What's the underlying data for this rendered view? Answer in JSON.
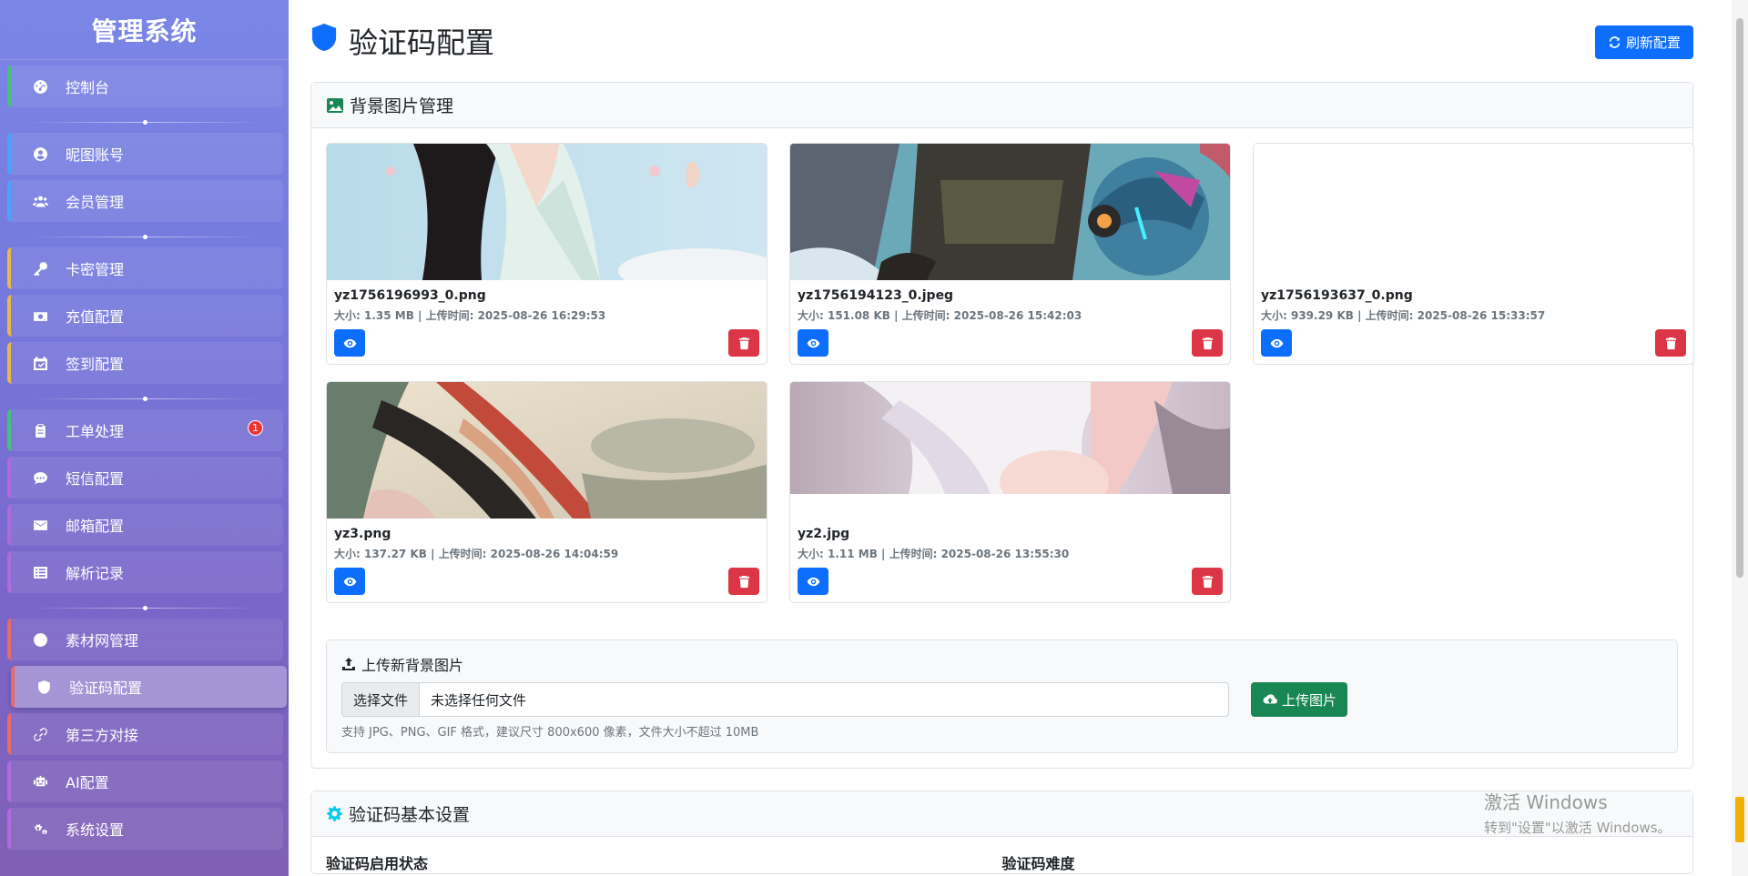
{
  "brand": "管理系统",
  "sidebar": {
    "items": [
      {
        "label": "控制台"
      },
      {
        "label": "昵图账号"
      },
      {
        "label": "会员管理"
      },
      {
        "label": "卡密管理"
      },
      {
        "label": "充值配置"
      },
      {
        "label": "签到配置"
      },
      {
        "label": "工单处理",
        "badge": "1"
      },
      {
        "label": "短信配置"
      },
      {
        "label": "邮箱配置"
      },
      {
        "label": "解析记录"
      },
      {
        "label": "素材网管理"
      },
      {
        "label": "验证码配置"
      },
      {
        "label": "第三方对接"
      },
      {
        "label": "AI配置"
      },
      {
        "label": "系统设置"
      }
    ]
  },
  "header": {
    "title": "验证码配置",
    "refresh_label": "刷新配置"
  },
  "bg_section": {
    "title": "背景图片管理",
    "images": [
      {
        "name": "yz1756196993_0.png",
        "meta": "大小: 1.35 MB | 上传时间: 2025-08-26 16:29:53"
      },
      {
        "name": "yz1756194123_0.jpeg",
        "meta": "大小: 151.08 KB | 上传时间: 2025-08-26 15:42:03"
      },
      {
        "name": "yz1756193637_0.png",
        "meta": "大小: 939.29 KB | 上传时间: 2025-08-26 15:33:57"
      },
      {
        "name": "yz3.png",
        "meta": "大小: 137.27 KB | 上传时间: 2025-08-26 14:04:59"
      },
      {
        "name": "yz2.jpg",
        "meta": "大小: 1.11 MB | 上传时间: 2025-08-26 13:55:30"
      }
    ]
  },
  "upload": {
    "title": "上传新背景图片",
    "choose_label": "选择文件",
    "file_status": "未选择任何文件",
    "button_label": "上传图片",
    "hint": "支持 JPG、PNG、GIF 格式，建议尺寸 800x600 像素，文件大小不超过 10MB"
  },
  "basic_section": {
    "title": "验证码基本设置",
    "enable_label": "验证码启用状态",
    "difficulty_label": "验证码难度"
  },
  "watermark": {
    "line1": "激活 Windows",
    "line2": "转到\"设置\"以激活 Windows。"
  },
  "colors": {
    "primary": "#0d6efd",
    "danger": "#dc3545",
    "success": "#198754",
    "sidebar_top": "#7b86e6",
    "sidebar_bottom": "#8060b5"
  }
}
